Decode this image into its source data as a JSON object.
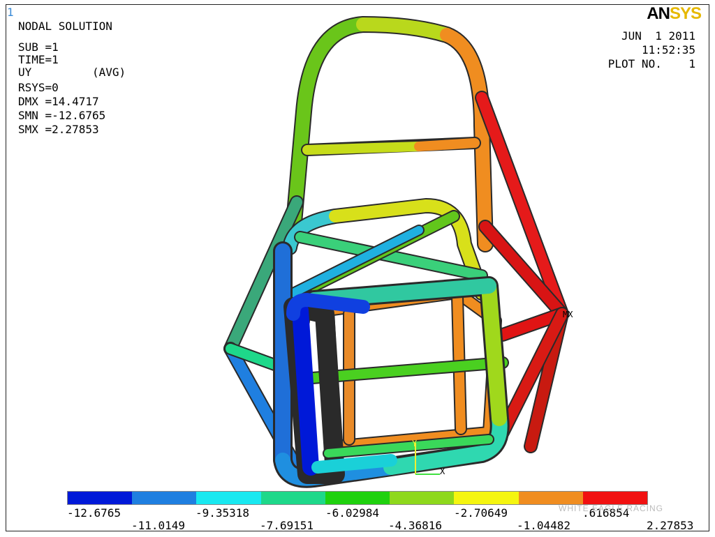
{
  "window_number": "1",
  "solution": {
    "title": "NODAL SOLUTION",
    "sub": "SUB =1",
    "time": "TIME=1",
    "component": "UY",
    "avg": "(AVG)",
    "rsys": "RSYS=0",
    "dmx": "DMX =14.4717",
    "smn": "SMN =-12.6765",
    "smx": "SMX =2.27853"
  },
  "brand": {
    "main": "AN",
    "accent": "SYS"
  },
  "header_right": {
    "date": "JUN  1 2011",
    "time": "11:52:35",
    "plot": "PLOT NO.    1"
  },
  "max_marker": "MX",
  "triad": {
    "x": "X",
    "y": "Y"
  },
  "legend": {
    "colors": [
      "#0019d8",
      "#1f7fe0",
      "#19e8f0",
      "#1ed88a",
      "#1fd10e",
      "#8ed81c",
      "#f5f510",
      "#f08d20",
      "#f11111"
    ],
    "labels_top": [
      "-12.6765",
      "-9.35318",
      "-6.02984",
      "-2.70649",
      ".616854"
    ],
    "labels_bottom": [
      "-11.0149",
      "-7.69151",
      "-4.36816",
      "-1.04482",
      "2.27853"
    ]
  },
  "watermark": "WHITE EAGLE RACING"
}
